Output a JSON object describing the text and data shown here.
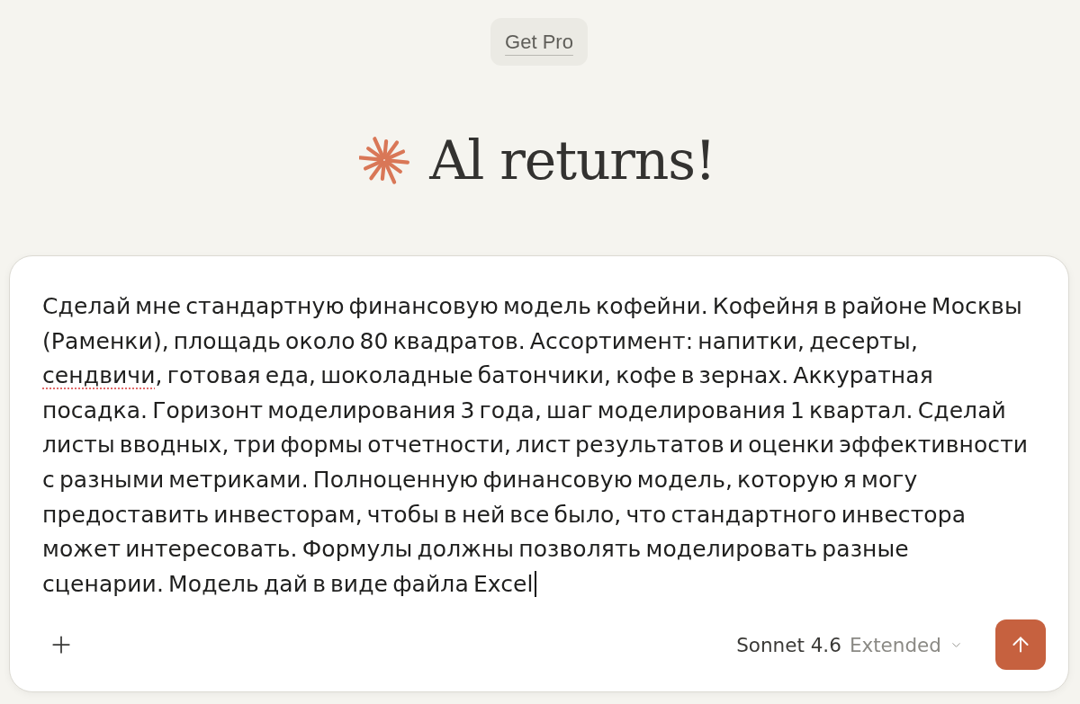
{
  "header": {
    "upgrade_button": "Get Pro"
  },
  "greeting": {
    "text": "Al returns!"
  },
  "composer": {
    "focused": true,
    "value": [
      {
        "text": "Сделай мне стандартную финансовую модель кофейни. Кофейня в районе Москвы (Раменки), площадь около 80 квадратов. Ассортимент: напитки, десерты, ",
        "misspelled": false
      },
      {
        "text": "сендвичи",
        "misspelled": true
      },
      {
        "text": ", готовая еда, шоколадные батончики, кофе в зернах. Аккуратная посадка. Горизонт моделирования 3 года, шаг моделирования 1 квартал. Сделай листы вводных, три формы отчетности, лист результатов и оценки эффективности с разными метриками. Полноценную финансовую модель, которую я могу предоставить инвесторам, чтобы в ней все было, что стандартного инвестора может интересовать. Формулы должны позволять моделировать разные сценарии. Модель дай в виде файла Excel",
        "misspelled": false
      }
    ],
    "model": {
      "name": "Sonnet 4.6",
      "mode": "Extended"
    },
    "send_button": {
      "disabled": false
    }
  }
}
